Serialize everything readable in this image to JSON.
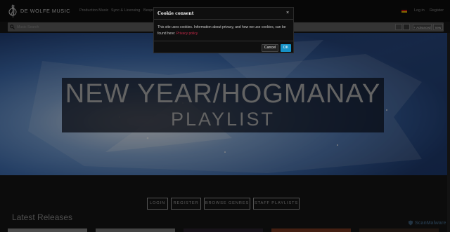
{
  "brand": {
    "name": "DE WOLFE MUSIC",
    "logo_icon": "treble-clef-logo"
  },
  "nav": {
    "items": [
      {
        "label": "Production Music"
      },
      {
        "label": "Sync & Licensing"
      },
      {
        "label": "Bespoke"
      }
    ],
    "login": "Log in",
    "register": "Register",
    "language_icon": "german-flag-icon"
  },
  "search": {
    "placeholder": "Music Search",
    "toggle_a": "",
    "toggle_b": "",
    "advanced": "+ Advanced",
    "new": "new"
  },
  "hero": {
    "title": "NEW YEAR/HOGMANAY",
    "subtitle": "PLAYLIST"
  },
  "actions": {
    "login": "LOGIN",
    "register": "REGISTER",
    "browse_genres": "BROWSE GENRES",
    "staff_playlists": "STAFF PLAYLISTS"
  },
  "sections": {
    "latest_releases": "Latest Releases"
  },
  "watermark": {
    "text": "ScanMalware"
  },
  "cookie_modal": {
    "title": "Cookie consent",
    "close": "×",
    "body": "This site uses cookies. Information about privacy, and how we use cookies, can be found here:",
    "link": "Privacy policy",
    "cancel": "Cancel",
    "ok": "OK"
  },
  "colors": {
    "background": "#161616",
    "accent_ok": "#1691c6",
    "link": "#c92a4a",
    "hero_blue": "#3f78c4"
  }
}
